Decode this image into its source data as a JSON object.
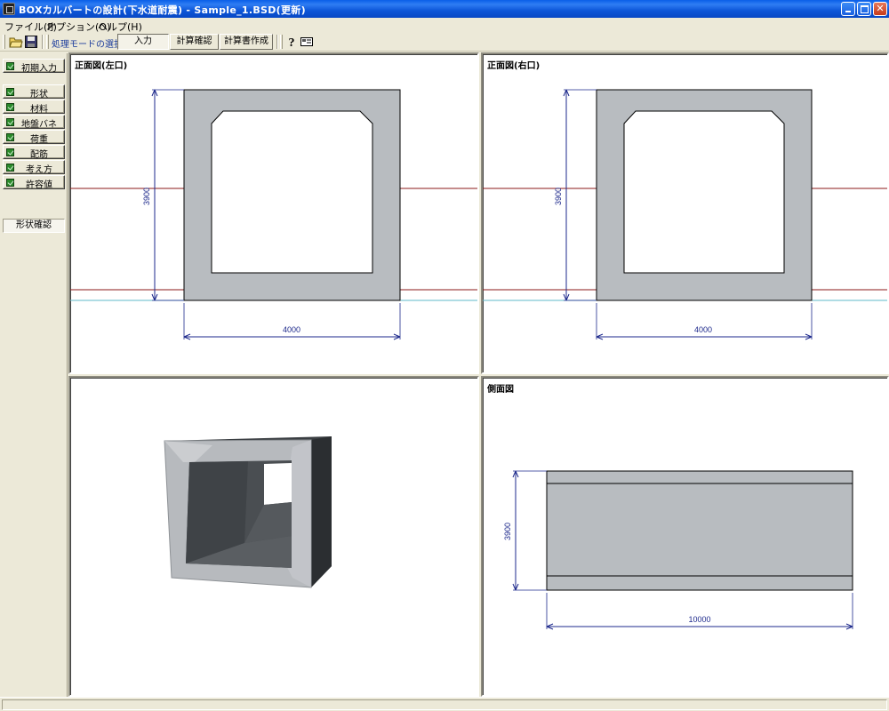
{
  "window": {
    "title": "BOXカルバートの設計(下水道耐震) - Sample_1.BSD(更新)"
  },
  "menu": {
    "items": [
      "ファイル(F)",
      "オプション(O)",
      "ヘルプ(H)"
    ]
  },
  "toolbar": {
    "mode_label": "処理モードの選択",
    "modes": [
      "入力",
      "計算確認",
      "計算書作成"
    ],
    "active_mode": "入力"
  },
  "sidebar": {
    "initial_input": "初期入力",
    "items": [
      "形状",
      "材料",
      "地盤バネ",
      "荷重",
      "配筋",
      "考え方",
      "許容値"
    ],
    "shape_check": "形状確認"
  },
  "views": {
    "front_left": {
      "title": "正面図(左口)",
      "height_label": "3900",
      "width_label": "4000"
    },
    "front_right": {
      "title": "正面図(右口)",
      "height_label": "3900",
      "width_label": "4000"
    },
    "view_3d": {
      "title": ""
    },
    "side": {
      "title": "側面図",
      "height_label": "3900",
      "length_label": "10000"
    }
  },
  "colors": {
    "concrete": "#b8bcc0",
    "dimension": "#1e2a8c",
    "ground_line": "#8b1a1a",
    "water_line": "#5fb8c8",
    "titlebar": "#0a5fe8"
  }
}
